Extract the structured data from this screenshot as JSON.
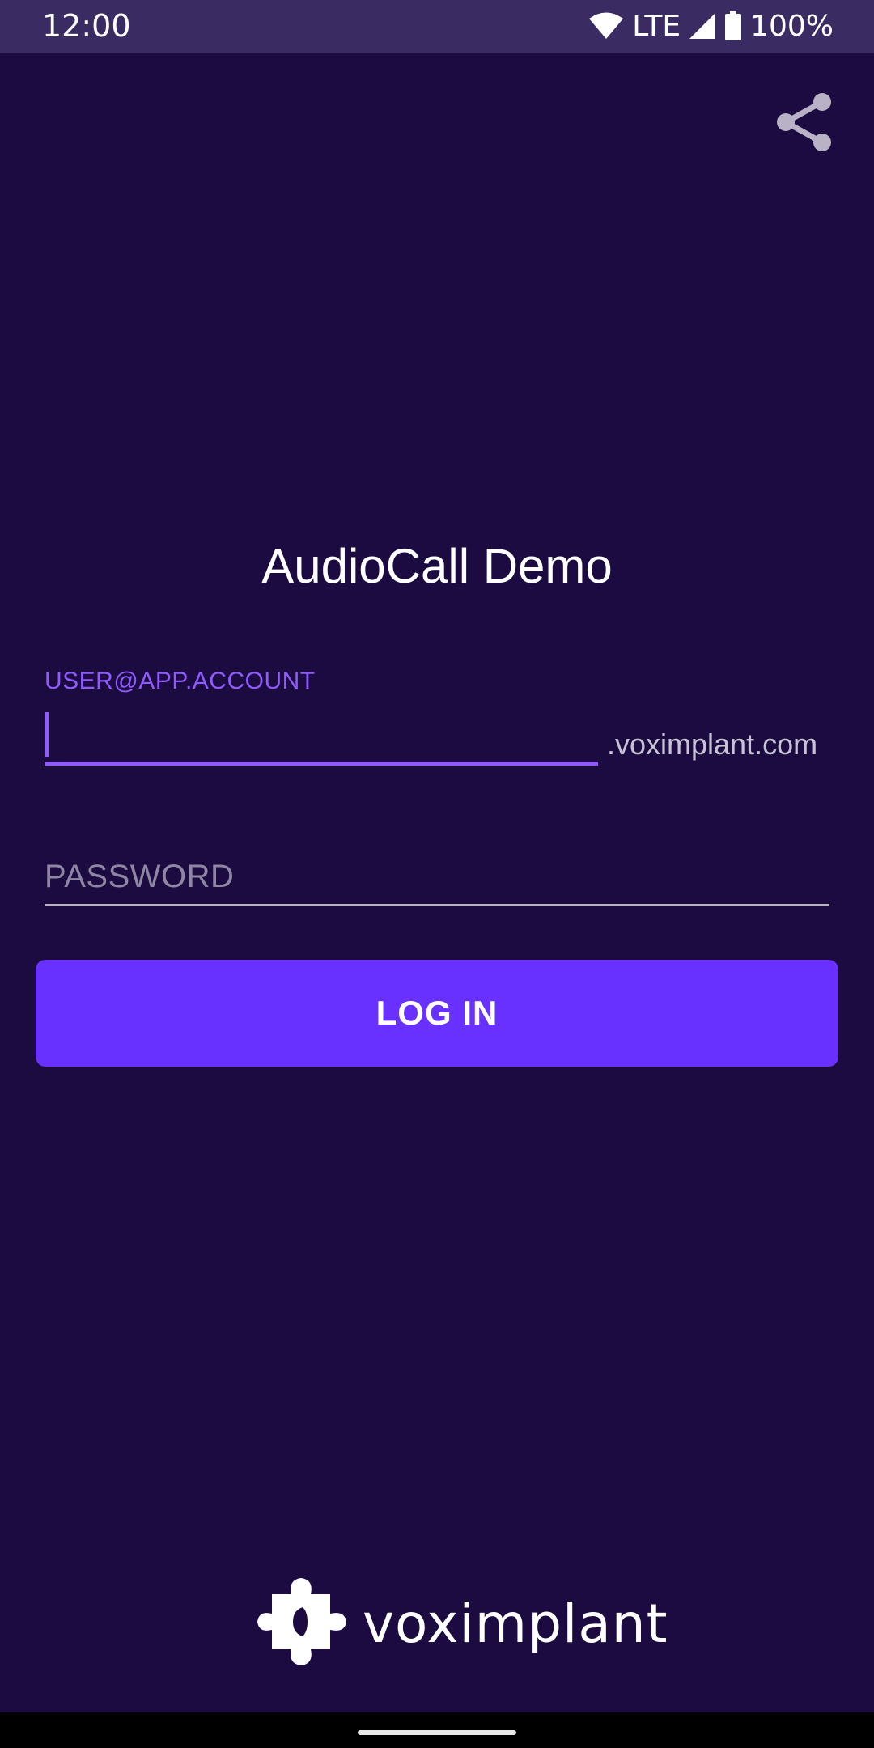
{
  "status_bar": {
    "time": "12:00",
    "network": "LTE",
    "battery": "100%",
    "icons": [
      "wifi-icon",
      "cellular-signal-icon",
      "battery-icon"
    ]
  },
  "toolbar": {
    "share_icon": "share-icon"
  },
  "login": {
    "title": "AudioCall Demo",
    "user_label": "USER@APP.ACCOUNT",
    "user_value": "",
    "domain_suffix": ".voximplant.com",
    "password_placeholder": "PASSWORD",
    "password_value": "",
    "login_button": "LOG IN"
  },
  "footer": {
    "brand": "voximplant",
    "logo_icon": "puzzle-logo-icon"
  },
  "colors": {
    "background": "#1c0b40",
    "status_bar": "#3b2b63",
    "accent": "#8f5bff",
    "button": "#6931ff"
  }
}
